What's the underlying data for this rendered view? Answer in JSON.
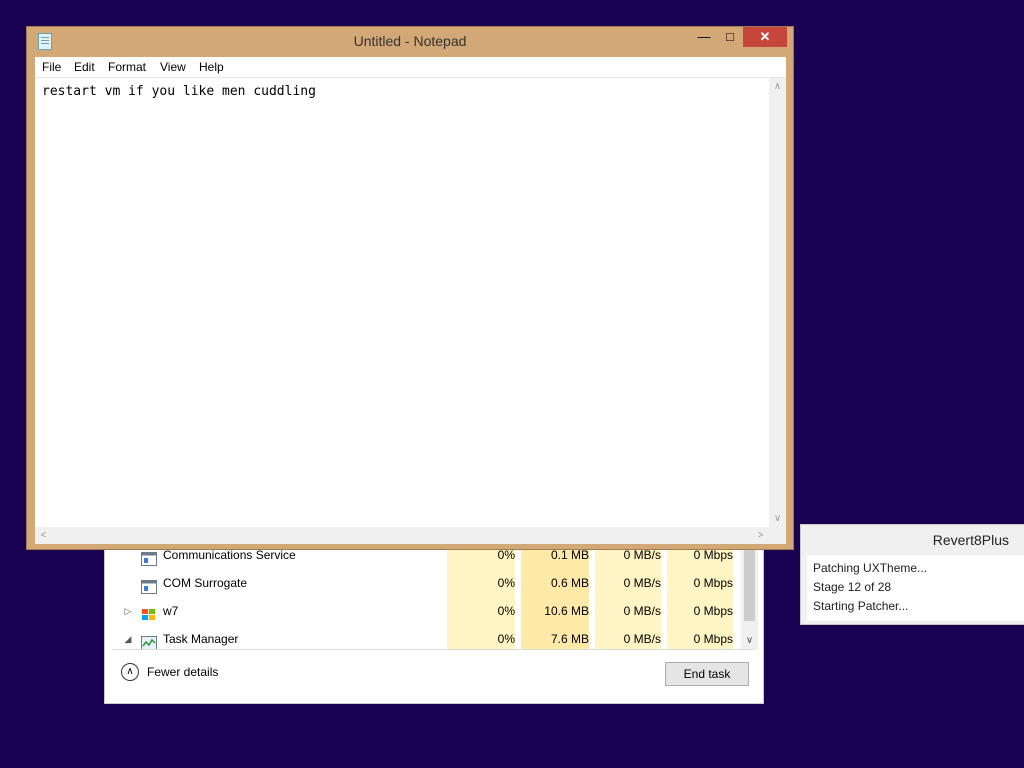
{
  "notepad": {
    "title": "Untitled - Notepad",
    "menu": [
      "File",
      "Edit",
      "Format",
      "View",
      "Help"
    ],
    "content": "restart vm if you like men cuddling",
    "caption": {
      "minimize": "—",
      "maximize": "□",
      "close": "✕"
    }
  },
  "task_manager": {
    "rows": [
      {
        "name": "Communications Service",
        "cpu": "0%",
        "memory": "0.1 MB",
        "disk": "0 MB/s",
        "network": "0 Mbps",
        "expander": "",
        "icon": "window-icon"
      },
      {
        "name": "COM Surrogate",
        "cpu": "0%",
        "memory": "0.6 MB",
        "disk": "0 MB/s",
        "network": "0 Mbps",
        "expander": "",
        "icon": "window-icon"
      },
      {
        "name": "w7",
        "cpu": "0%",
        "memory": "10.6 MB",
        "disk": "0 MB/s",
        "network": "0 Mbps",
        "expander": "▷",
        "icon": "windows-logo-icon"
      },
      {
        "name": "Task Manager",
        "cpu": "0%",
        "memory": "7.6 MB",
        "disk": "0 MB/s",
        "network": "0 Mbps",
        "expander": "◢",
        "icon": "task-manager-icon"
      }
    ],
    "fewer_details": "Fewer details",
    "end_task": "End task"
  },
  "revert8plus": {
    "title": "Revert8Plus",
    "lines": [
      "Patching UXTheme...",
      "Stage 12 of 28",
      "Starting Patcher..."
    ]
  },
  "colors": {
    "desktop": "#1a0050",
    "window_frame": "#d3a877",
    "close_button": "#c7463c",
    "cpu_column": "#fff4c4",
    "memory_column": "#ffe9a8"
  }
}
